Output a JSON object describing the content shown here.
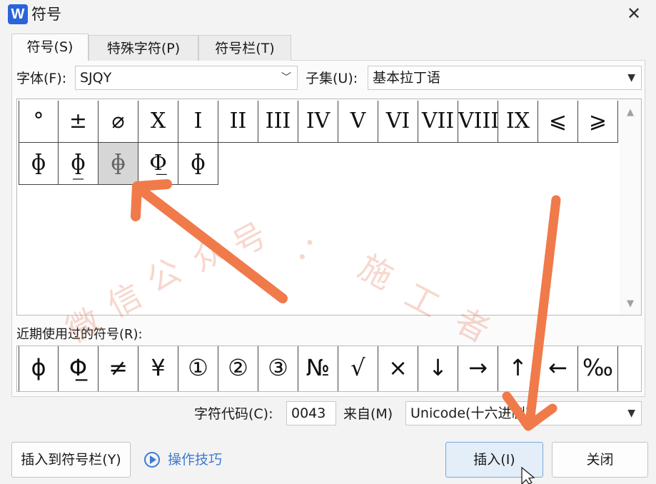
{
  "window": {
    "app_icon": "W",
    "title": "符号",
    "close_glyph": "✕"
  },
  "tabs": [
    {
      "label": "符号(S)",
      "active": true
    },
    {
      "label": "特殊字符(P)",
      "active": false
    },
    {
      "label": "符号栏(T)",
      "active": false
    }
  ],
  "font_row": {
    "font_label": "字体(F):",
    "font_value": "SJQY",
    "subset_label": "子集(U):",
    "subset_value": "基本拉丁语"
  },
  "symbol_grid": {
    "row1": [
      "°",
      "±",
      "⌀",
      "X",
      "I",
      "II",
      "III",
      "IV",
      "V",
      "VI",
      "VII",
      "VIII",
      "IX",
      "⩽",
      "⩾"
    ],
    "row2": [
      "ɸ",
      "ɸ̲",
      "ɸ̶",
      "Φ̲",
      "ɸ"
    ],
    "selected_index_row2": 2
  },
  "recent": {
    "label": "近期使用过的符号(R):",
    "items": [
      "ɸ",
      "Φ̲",
      "≠",
      "¥",
      "①",
      "②",
      "③",
      "№",
      "√",
      "×",
      "↓",
      "→",
      "↑",
      "←",
      "‰"
    ]
  },
  "code_row": {
    "code_label": "字符代码(C):",
    "code_value": "0043",
    "from_label": "来自(M)",
    "from_value": "Unicode(十六进制)"
  },
  "buttons": {
    "insert_to_bar": "插入到符号栏(Y)",
    "tips": "操作技巧",
    "insert": "插入(I)",
    "close": "关闭"
  },
  "watermark": [
    "微",
    "信",
    "公",
    "众",
    "号",
    "：",
    "施",
    "工",
    "者"
  ],
  "colors": {
    "arrow": "#f07a4a",
    "accent_blue": "#3d7ad1",
    "app_icon_bg": "#2b63d9"
  },
  "icons": {
    "close": "close-icon",
    "dropdown": "chevron-down-icon",
    "tips": "play-circle-icon",
    "cursor": "mouse-pointer-icon"
  }
}
